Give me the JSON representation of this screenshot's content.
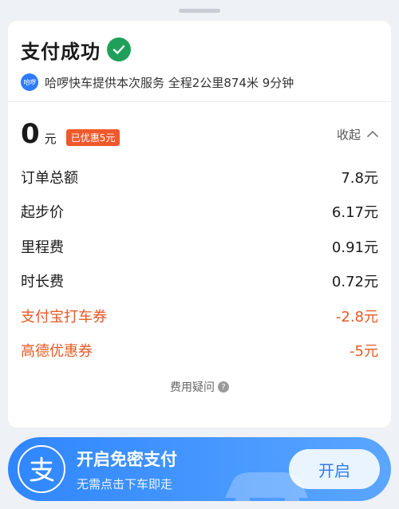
{
  "header": {
    "title": "支付成功",
    "provider_icon_text": "哈啰",
    "service_info": "哈啰快车提供本次服务 全程2公里874米 9分钟"
  },
  "summary": {
    "amount": "0",
    "currency": "元",
    "discount_badge": "已优惠5元",
    "collapse_label": "收起"
  },
  "fees": [
    {
      "label": "订单总额",
      "value": "7.8元",
      "highlight": false
    },
    {
      "label": "起步价",
      "value": "6.17元",
      "highlight": false
    },
    {
      "label": "里程费",
      "value": "0.91元",
      "highlight": false
    },
    {
      "label": "时长费",
      "value": "0.72元",
      "highlight": false
    },
    {
      "label": "支付宝打车券",
      "value": "-2.8元",
      "highlight": true
    },
    {
      "label": "高德优惠券",
      "value": "-5元",
      "highlight": true
    }
  ],
  "faq": {
    "label": "费用疑问",
    "icon": "help-icon"
  },
  "banner": {
    "title": "开启免密支付",
    "subtitle": "无需点击下车即走",
    "button_label": "开启",
    "logo_icon": "alipay-icon"
  },
  "colors": {
    "success": "#1fa05a",
    "discount": "#e55a24",
    "banner": "#2f86ff"
  }
}
